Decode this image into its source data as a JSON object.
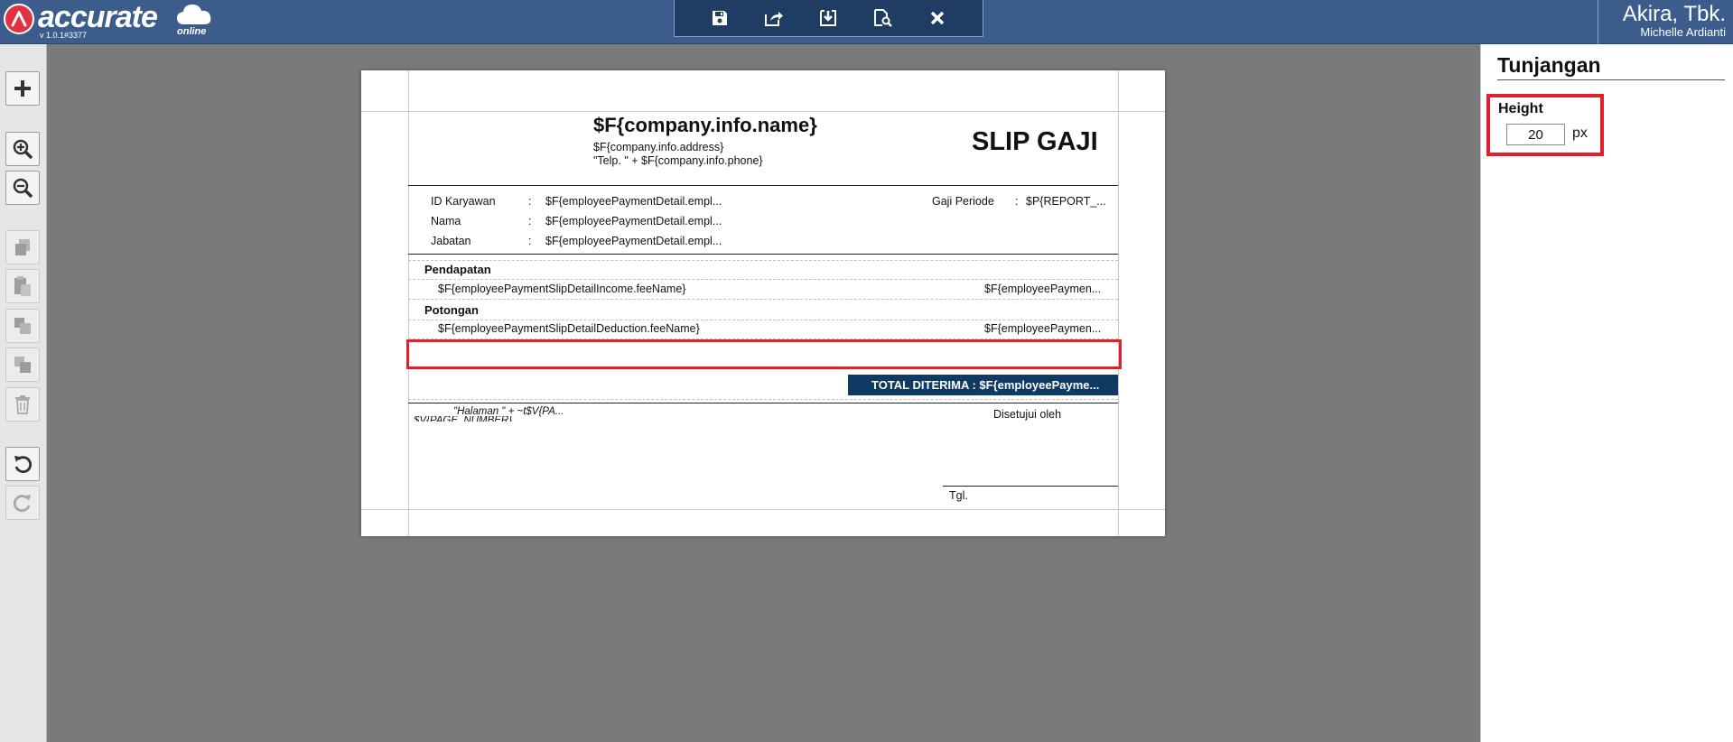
{
  "app": {
    "logo_text": "accurate",
    "logo_sub": "online",
    "version": "v 1.0.1#3377",
    "company_name": "Akira, Tbk.",
    "user_name": "Michelle Ardianti"
  },
  "toolbar": {
    "icons": [
      "save-icon",
      "export-icon",
      "download-icon",
      "preview-icon",
      "close-icon"
    ]
  },
  "left_tools": {
    "icons": [
      "add-icon",
      "zoom-in-icon",
      "zoom-out-icon",
      "copy-icon",
      "paste-icon",
      "bring-front-icon",
      "send-back-icon",
      "delete-icon",
      "undo-icon",
      "redo-icon"
    ]
  },
  "report": {
    "company_name": "$F{company.info.name}",
    "company_address": "$F{company.info.address}",
    "company_phone": "\"Telp. \" + $F{company.info.phone}",
    "title": "SLIP GAJI",
    "fields": [
      {
        "label": "ID Karyawan",
        "sep": ":",
        "value": "$F{employeePaymentDetail.empl..."
      },
      {
        "label": "Nama",
        "sep": ":",
        "value": "$F{employeePaymentDetail.empl..."
      },
      {
        "label": "Jabatan",
        "sep": ":",
        "value": "$F{employeePaymentDetail.empl..."
      }
    ],
    "period_label": "Gaji Periode",
    "period_sep": ":",
    "period_value": "$P{REPORT_...",
    "income_header": "Pendapatan",
    "income_name": "$F{employeePaymentSlipDetailIncome.feeName}",
    "income_value": "$F{employeePaymen...",
    "deduction_header": "Potongan",
    "deduction_name": "$F{employeePaymentSlipDetailDeduction.feeName}",
    "deduction_value": "$F{employeePaymen...",
    "total_label": "TOTAL DITERIMA : $F{employeePayme...",
    "page_expr": "\"Halaman \" + ~t$V{PA...",
    "page_expr2": "$V{PAGE_NUMBER}",
    "approved_label": "Disetujui oleh",
    "date_label": "Tgl."
  },
  "properties": {
    "title": "Tunjangan",
    "height_label": "Height",
    "height_value": "20",
    "height_unit": "px"
  },
  "colors": {
    "topbar": "#3c5d8c",
    "highlight": "#e0202b",
    "total_bg": "#0e3a63"
  }
}
